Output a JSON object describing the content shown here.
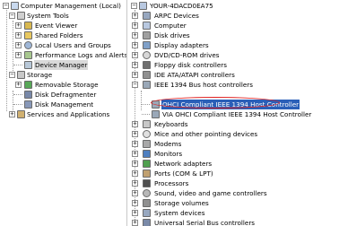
{
  "left_tree": {
    "root": "Computer Management (Local)",
    "system_tools": "System Tools",
    "event_viewer": "Event Viewer",
    "shared_folders": "Shared Folders",
    "local_users": "Local Users and Groups",
    "perf_logs": "Performance Logs and Alerts",
    "device_manager": "Device Manager",
    "storage": "Storage",
    "removable_storage": "Removable Storage",
    "disk_defrag": "Disk Defragmenter",
    "disk_mgmt": "Disk Management",
    "services_apps": "Services and Applications"
  },
  "right_tree": {
    "computer_name": "YOUR-4DACD0EA75",
    "arpc": "ARPC Devices",
    "computer": "Computer",
    "disk_drives": "Disk drives",
    "display": "Display adapters",
    "dvd": "DVD/CD-ROM drives",
    "floppy": "Floppy disk controllers",
    "ide": "IDE ATA/ATAPI controllers",
    "ieee": "IEEE 1394 Bus host controllers",
    "ohci": "OHCI Compliant IEEE 1394 Host Controller",
    "via": "VIA OHCI Compliant IEEE 1394 Host Controller",
    "keyboards": "Keyboards",
    "mice": "Mice and other pointing devices",
    "modems": "Modems",
    "monitors": "Monitors",
    "network": "Network adapters",
    "ports": "Ports (COM & LPT)",
    "processors": "Processors",
    "sound": "Sound, video and game controllers",
    "storage_vol": "Storage volumes",
    "system_devices": "System devices",
    "usb": "Universal Serial Bus controllers"
  },
  "expanders": {
    "plus": "+",
    "minus": "−"
  },
  "colors": {
    "highlight": "#2a5fb8",
    "annotation": "#e02020",
    "selected_bg": "#d9d9d9"
  }
}
